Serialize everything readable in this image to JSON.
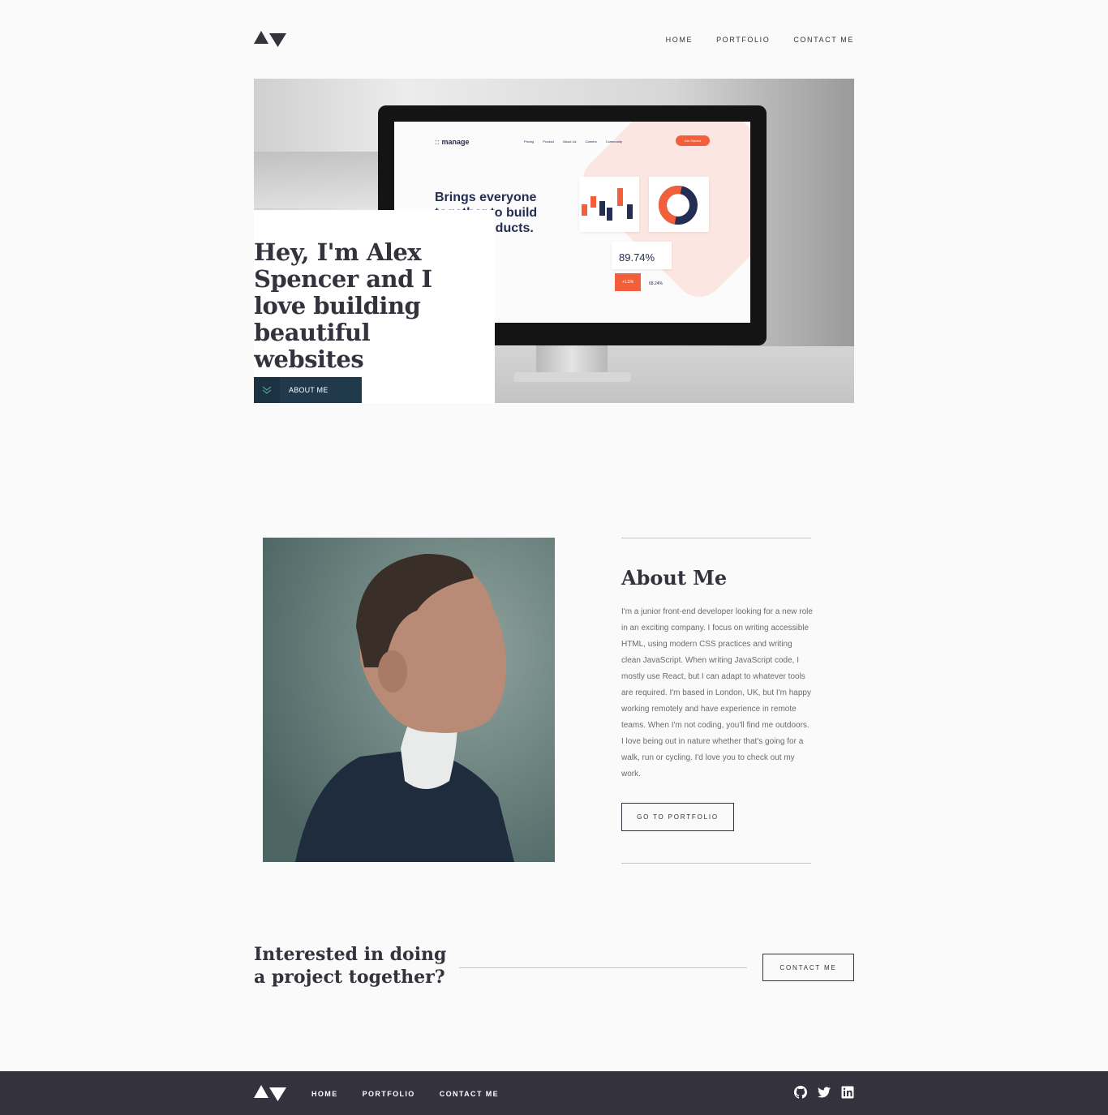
{
  "header": {
    "logo": "logo-icon",
    "nav": [
      {
        "label": "HOME"
      },
      {
        "label": "PORTFOLIO"
      },
      {
        "label": "CONTACT ME"
      }
    ]
  },
  "hero": {
    "title": "Hey, I'm Alex Spencer and I love building beautiful websites",
    "button_label": "ABOUT ME",
    "button_icon": "chevrons-down-icon",
    "screen": {
      "logo": "manage",
      "menu": [
        "Pricing",
        "Product",
        "About Us",
        "Careers",
        "Community"
      ],
      "cta": "Get Started",
      "headline": "Brings everyone together to build better products.",
      "stat_main": "89.74%",
      "stat_red": "+1.5%",
      "stat_small": "68.24%"
    }
  },
  "about": {
    "title": "About Me",
    "text": "I'm a junior front-end developer looking for a new role in an exciting company. I focus on writing accessible HTML, using modern CSS practices and writing clean JavaScript. When writing JavaScript code, I mostly use React, but I can adapt to whatever tools are required. I'm based in London, UK, but I'm happy working remotely and have experience in remote teams. When I'm not coding, you'll find me outdoors. I love being out in nature whether that's going for a walk, run or cycling. I'd love you to check out my work.",
    "button_label": "GO TO PORTFOLIO"
  },
  "contact": {
    "title": "Interested in doing a project together?",
    "button_label": "CONTACT ME"
  },
  "footer": {
    "nav": [
      {
        "label": "HOME"
      },
      {
        "label": "PORTFOLIO"
      },
      {
        "label": "CONTACT ME"
      }
    ],
    "social": [
      "github-icon",
      "twitter-icon",
      "linkedin-icon"
    ]
  },
  "colors": {
    "dark": "#33323d",
    "hero_button": "#203a4c",
    "body_text": "#6b6a72",
    "accent_orange": "#f25f3a"
  }
}
